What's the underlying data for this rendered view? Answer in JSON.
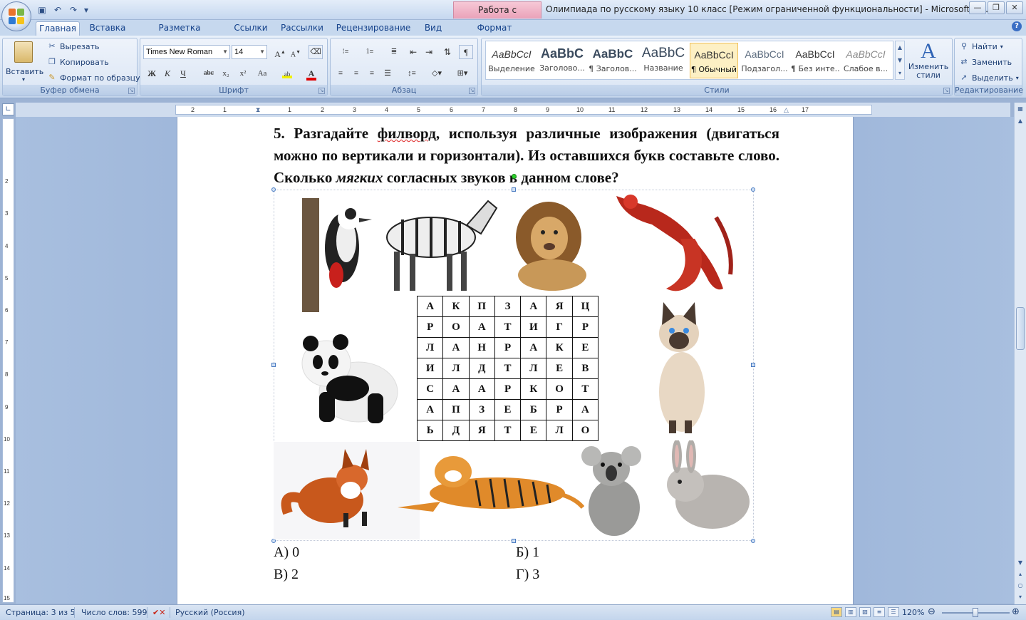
{
  "window": {
    "title": "Олимпиада по русскому языку 10 класс [Режим ограниченной функциональности] - Microsoft W...",
    "context_tab": "Работа с рисунками",
    "controls": [
      "minimize-icon",
      "restore-icon",
      "close-icon"
    ]
  },
  "quick_access": [
    "save-icon",
    "undo-icon",
    "redo-icon",
    "customize-icon"
  ],
  "tabs": [
    "Главная",
    "Вставка",
    "Разметка страницы",
    "Ссылки",
    "Рассылки",
    "Рецензирование",
    "Вид",
    "Формат"
  ],
  "active_tab": "Главная",
  "ribbon": {
    "clipboard": {
      "label": "Буфер обмена",
      "paste": "Вставить",
      "cut": "Вырезать",
      "copy": "Копировать",
      "format_painter": "Формат по образцу"
    },
    "font": {
      "label": "Шрифт",
      "font_name": "Times New Roman",
      "font_size": "14",
      "bold": "Ж",
      "italic": "К",
      "underline": "Ч",
      "strike": "abc",
      "subscript": "x₂",
      "superscript": "x²",
      "change_case": "Аа",
      "font_color_color": "#e00000"
    },
    "paragraph": {
      "label": "Абзац",
      "show_marks": "¶"
    },
    "styles": {
      "label": "Стили",
      "items": [
        {
          "preview": "AaBbCcI",
          "name": "Выделение"
        },
        {
          "preview": "AaBbC",
          "name": "Заголово..."
        },
        {
          "preview": "AaBbC",
          "name": "¶ Заголов..."
        },
        {
          "preview": "AaBbC",
          "name": "Название"
        },
        {
          "preview": "AaBbCcI",
          "name": "¶ Обычный"
        },
        {
          "preview": "AaBbCcI",
          "name": "Подзагол..."
        },
        {
          "preview": "AaBbCcI",
          "name": "¶ Без инте..."
        },
        {
          "preview": "AaBbCcI",
          "name": "Слабое в..."
        }
      ],
      "change_styles": "Изменить стили"
    },
    "editing": {
      "label": "Редактирование",
      "find": "Найти",
      "replace": "Заменить",
      "select": "Выделить"
    }
  },
  "document": {
    "question_number": "5.",
    "question_part1": "Разгадайте ",
    "question_word_underlined": "филворд",
    "question_part2": ", используя различные изображения (двигаться можно по вертикали и горизонтали). Из оставшихся букв составьте слово. Сколько ",
    "question_italic": "мягких",
    "question_part3": " согласных звуков в данном слове?",
    "grid": [
      [
        "А",
        "К",
        "П",
        "З",
        "А",
        "Я",
        "Ц"
      ],
      [
        "Р",
        "О",
        "А",
        "Т",
        "И",
        "Г",
        "Р"
      ],
      [
        "Л",
        "А",
        "Н",
        "Р",
        "А",
        "К",
        "Е"
      ],
      [
        "И",
        "Л",
        "Д",
        "Т",
        "Л",
        "Е",
        "В"
      ],
      [
        "С",
        "А",
        "А",
        "Р",
        "К",
        "О",
        "Т"
      ],
      [
        "А",
        "П",
        "З",
        "Е",
        "Б",
        "Р",
        "А"
      ],
      [
        "Ь",
        "Д",
        "Я",
        "Т",
        "Е",
        "Л",
        "О"
      ]
    ],
    "pictures": [
      "woodpecker",
      "zebra",
      "lion",
      "crayfish",
      "panda",
      "cat",
      "fox",
      "tiger",
      "koala",
      "rabbit"
    ],
    "answers": [
      "А) 0",
      "Б) 1",
      "В) 2",
      "Г) 3"
    ]
  },
  "status_bar": {
    "page": "Страница: 3 из 5",
    "words": "Число слов: 599",
    "language": "Русский (Россия)",
    "zoom": "120%"
  },
  "colors": {
    "ribbon_accent": "#15428b",
    "context_tab": "#eaa2b9",
    "workspace": "#8fa9d2"
  }
}
